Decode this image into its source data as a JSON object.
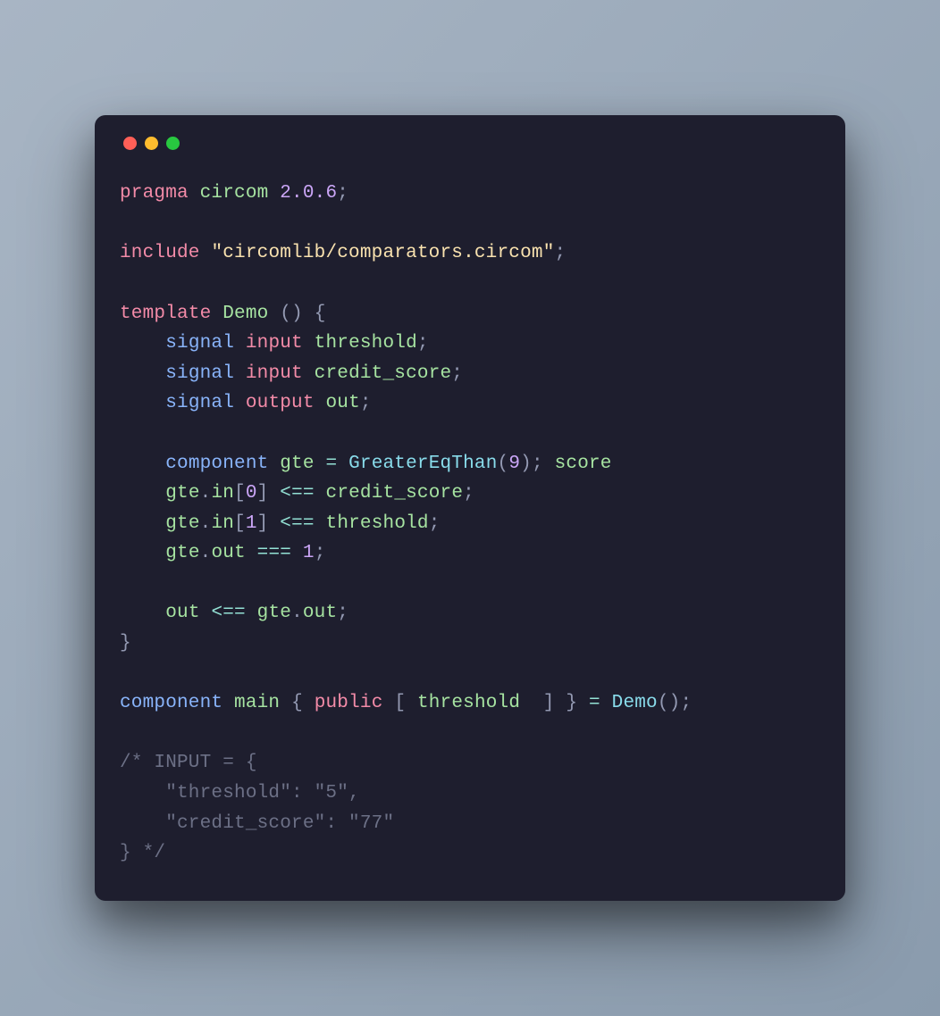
{
  "theme": {
    "bg_start": "#a8b5c4",
    "bg_end": "#8a9bad",
    "window_bg": "#1e1e2e",
    "dot_red": "#ff5f57",
    "dot_yellow": "#febc2e",
    "dot_green": "#28c840",
    "keyword": "#f38ba8",
    "identifier": "#a6e3a1",
    "string": "#f9e2af",
    "number": "#cba6f7",
    "punct": "#9399b2",
    "operator": "#94e2d5",
    "comment": "#6c7086"
  },
  "code": {
    "raw": "pragma circom 2.0.6;\n\ninclude \"circomlib/comparators.circom\";\n\ntemplate Demo () {\n    signal input threshold;\n    signal input credit_score;\n    signal output out;\n\n    component gte = GreaterEqThan(9); score\n    gte.in[0] <== credit_score;\n    gte.in[1] <== threshold;\n    gte.out === 1;\n\n    out <== gte.out;\n}\n\ncomponent main { public [ threshold  ] } = Demo();\n\n/* INPUT = {\n    \"threshold\": \"5\",\n    \"credit_score\": \"77\"\n} */",
    "tokens": {
      "pragma": "pragma",
      "circom": "circom",
      "version": "2.0.6",
      "include": "include",
      "include_path": "\"circomlib/comparators.circom\"",
      "template": "template",
      "demo": "Demo",
      "signal": "signal",
      "input": "input",
      "output_kw": "output",
      "threshold": "threshold",
      "credit_score": "credit_score",
      "out": "out",
      "component": "component",
      "gte": "gte",
      "greater_eq": "GreaterEqThan",
      "nine": "9",
      "score": "score",
      "in": "in",
      "zero": "0",
      "one": "1",
      "arrow": "<==",
      "tripleeq": "===",
      "main": "main",
      "public": "public",
      "eq": "=",
      "semi": ";",
      "lparen": "(",
      "rparen": ")",
      "lbrace": "{",
      "rbrace": "}",
      "lbracket": "[",
      "rbracket": "]",
      "dot": ".",
      "comment_open": "/* ",
      "comment_input": "INPUT = {",
      "comment_l1": "    \"threshold\": \"5\",",
      "comment_l2": "    \"credit_score\": \"77\"",
      "comment_close": "} */"
    }
  }
}
